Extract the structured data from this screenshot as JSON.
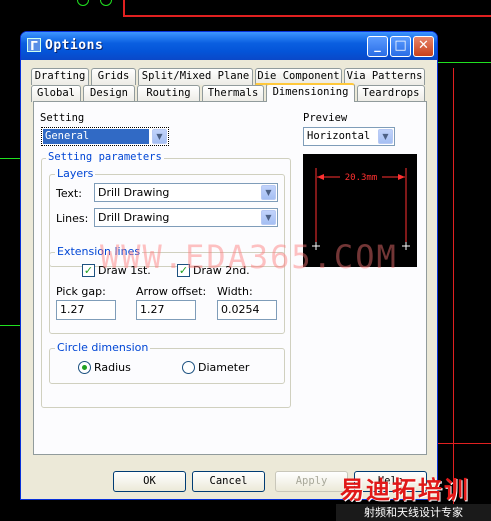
{
  "window": {
    "title": "Options",
    "buttons": [
      "minimize",
      "maximize",
      "close"
    ]
  },
  "tabs_row1": [
    "Drafting",
    "Grids",
    "Split/Mixed Plane",
    "Die Component",
    "Via Patterns"
  ],
  "tabs_row2": [
    "Global",
    "Design",
    "Routing",
    "Thermals",
    "Dimensioning",
    "Teardrops"
  ],
  "active_tab": "Dimensioning",
  "setting": {
    "label": "Setting",
    "value": "General"
  },
  "preview": {
    "label": "Preview",
    "value": "Horizontal",
    "dimension_text": "20.3mm"
  },
  "setting_parameters": {
    "label": "Setting parameters"
  },
  "layers": {
    "label": "Layers",
    "text_label": "Text:",
    "text_value": "Drill Drawing",
    "lines_label": "Lines:",
    "lines_value": "Drill Drawing"
  },
  "extension_lines": {
    "label": "Extension lines",
    "draw1_label": "Draw 1st.",
    "draw1_checked": true,
    "draw2_label": "Draw 2nd.",
    "draw2_checked": true,
    "pick_gap_label": "Pick gap:",
    "pick_gap_value": "1.27",
    "arrow_offset_label": "Arrow offset:",
    "arrow_offset_value": "1.27",
    "width_label": "Width:",
    "width_value": "0.0254"
  },
  "circle_dimension": {
    "label": "Circle dimension",
    "radius_label": "Radius",
    "diameter_label": "Diameter",
    "selected": "Radius"
  },
  "footer_buttons": {
    "ok": "OK",
    "cancel": "Cancel",
    "apply": "Apply",
    "help": "Help"
  },
  "watermark": "WWW.EDA365.COM",
  "logo_text": "易迪拓培训",
  "logo_subtext": "射频和天线设计专家",
  "colors": {
    "titlebar": "#0a5fe0",
    "background_lines": "#ff2020",
    "tab_highlight": "#ffc83c",
    "dimension": "#ff3030"
  }
}
